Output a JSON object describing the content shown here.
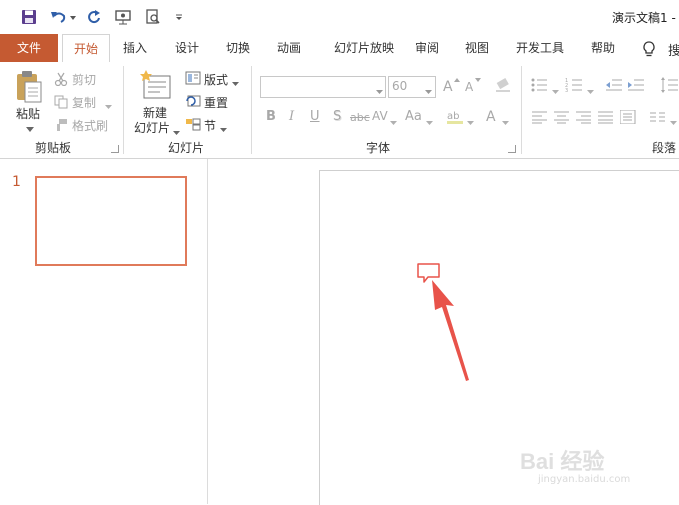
{
  "title": "演示文稿1  -",
  "tabs": [
    "文件",
    "开始",
    "插入",
    "设计",
    "切换",
    "动画",
    "幻灯片放映",
    "审阅",
    "视图",
    "开发工具",
    "帮助"
  ],
  "ribbon": {
    "clipboard": {
      "paste": "粘贴",
      "cut": "剪切",
      "copy": "复制",
      "format_painter": "格式刷",
      "label": "剪贴板"
    },
    "slides": {
      "new_slide_1": "新建",
      "new_slide_2": "幻灯片",
      "layout": "版式",
      "reset": "重置",
      "section": "节",
      "label": "幻灯片"
    },
    "font": {
      "size": "60",
      "bold": "B",
      "italic": "I",
      "underline": "U",
      "shadow": "S",
      "strike": "abc",
      "spacing": "AV",
      "case": "Aa",
      "label": "字体"
    },
    "paragraph": {
      "label": "段落"
    }
  },
  "slide_panel": {
    "number": "1"
  },
  "watermark": {
    "text": "Bai 经验",
    "url": "jingyan.baidu.com"
  },
  "colors": {
    "accent": "#c55a32",
    "arrow": "#e8534a"
  }
}
